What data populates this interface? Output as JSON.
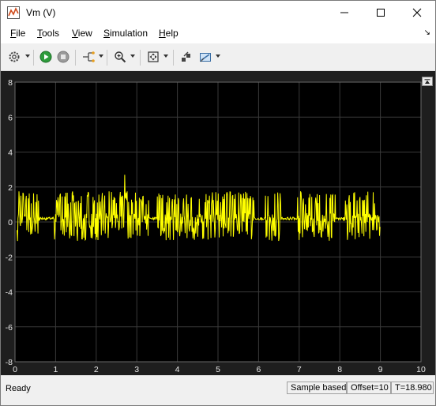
{
  "window": {
    "title": "Vm (V)"
  },
  "menu": {
    "items": [
      {
        "key": "F",
        "rest": "ile"
      },
      {
        "key": "T",
        "rest": "ools"
      },
      {
        "key": "V",
        "rest": "iew"
      },
      {
        "key": "S",
        "rest": "imulation"
      },
      {
        "key": "H",
        "rest": "elp"
      }
    ]
  },
  "toolbar": {
    "buttons": [
      "settings-icon",
      "run-icon",
      "stop-icon",
      "signal-selector-icon",
      "zoom-in-icon",
      "fit-to-view-icon",
      "autoscale-icon",
      "style-icon"
    ]
  },
  "status": {
    "ready": "Ready",
    "mode": "Sample based",
    "offset": "Offset=10",
    "time": "T=18.980"
  },
  "chart_data": {
    "type": "line",
    "xlim": [
      0,
      10
    ],
    "ylim": [
      -8,
      8
    ],
    "xticks": [
      "0",
      "1",
      "2",
      "3",
      "4",
      "5",
      "6",
      "7",
      "8",
      "9",
      "10"
    ],
    "yticks": [
      "8",
      "6",
      "4",
      "2",
      "0",
      "-2",
      "-4",
      "-6",
      "-8"
    ],
    "grid": true,
    "line_color": "#ffff00",
    "background": "#000000",
    "series": [
      {
        "x_range": [
          0.05,
          9.0
        ],
        "baseline": 0.2,
        "y_max": 2.7,
        "y_min": -1.3,
        "spike_at": 2.7
      }
    ]
  }
}
